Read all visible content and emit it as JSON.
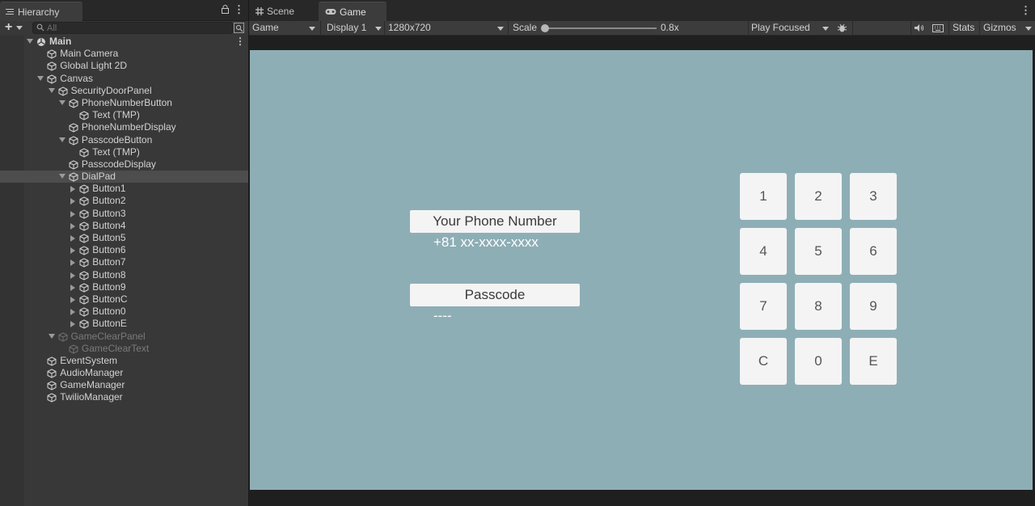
{
  "hierarchy": {
    "tab_label": "Hierarchy",
    "search_placeholder": "All",
    "items": [
      {
        "label": "Main",
        "depth": 0,
        "expand": "open",
        "scene": true
      },
      {
        "label": "Main Camera",
        "depth": 1
      },
      {
        "label": "Global Light 2D",
        "depth": 1
      },
      {
        "label": "Canvas",
        "depth": 1,
        "expand": "open"
      },
      {
        "label": "SecurityDoorPanel",
        "depth": 2,
        "expand": "open"
      },
      {
        "label": "PhoneNumberButton",
        "depth": 3,
        "expand": "open"
      },
      {
        "label": "Text (TMP)",
        "depth": 4
      },
      {
        "label": "PhoneNumberDisplay",
        "depth": 3
      },
      {
        "label": "PasscodeButton",
        "depth": 3,
        "expand": "open"
      },
      {
        "label": "Text (TMP)",
        "depth": 4
      },
      {
        "label": "PasscodeDisplay",
        "depth": 3
      },
      {
        "label": "DialPad",
        "depth": 3,
        "expand": "open",
        "selected": true
      },
      {
        "label": "Button1",
        "depth": 4,
        "expand": "closed"
      },
      {
        "label": "Button2",
        "depth": 4,
        "expand": "closed"
      },
      {
        "label": "Button3",
        "depth": 4,
        "expand": "closed"
      },
      {
        "label": "Button4",
        "depth": 4,
        "expand": "closed"
      },
      {
        "label": "Button5",
        "depth": 4,
        "expand": "closed"
      },
      {
        "label": "Button6",
        "depth": 4,
        "expand": "closed"
      },
      {
        "label": "Button7",
        "depth": 4,
        "expand": "closed"
      },
      {
        "label": "Button8",
        "depth": 4,
        "expand": "closed"
      },
      {
        "label": "Button9",
        "depth": 4,
        "expand": "closed"
      },
      {
        "label": "ButtonC",
        "depth": 4,
        "expand": "closed"
      },
      {
        "label": "Button0",
        "depth": 4,
        "expand": "closed"
      },
      {
        "label": "ButtonE",
        "depth": 4,
        "expand": "closed"
      },
      {
        "label": "GameClearPanel",
        "depth": 2,
        "expand": "open",
        "inactive": true
      },
      {
        "label": "GameClearText",
        "depth": 3,
        "inactive": true
      },
      {
        "label": "EventSystem",
        "depth": 1
      },
      {
        "label": "AudioManager",
        "depth": 1
      },
      {
        "label": "GameManager",
        "depth": 1
      },
      {
        "label": "TwilioManager",
        "depth": 1
      }
    ]
  },
  "view_tabs": {
    "scene": "Scene",
    "game": "Game"
  },
  "toolbar": {
    "mode": "Game",
    "display": "Display 1",
    "resolution": "1280x720",
    "scale_label": "Scale",
    "scale_value": "0.8x",
    "play_mode": "Play Focused",
    "stats": "Stats",
    "gizmos": "Gizmos"
  },
  "game": {
    "phone_button_label": "Your Phone Number",
    "phone_value": "+81 xx-xxxx-xxxx",
    "passcode_button_label": "Passcode",
    "passcode_value": "----",
    "keys": [
      "1",
      "2",
      "3",
      "4",
      "5",
      "6",
      "7",
      "8",
      "9",
      "C",
      "0",
      "E"
    ]
  },
  "colors": {
    "game_background": "#8eaeb6",
    "editor_panel": "#383838",
    "selected_row": "#4d4d4d"
  }
}
